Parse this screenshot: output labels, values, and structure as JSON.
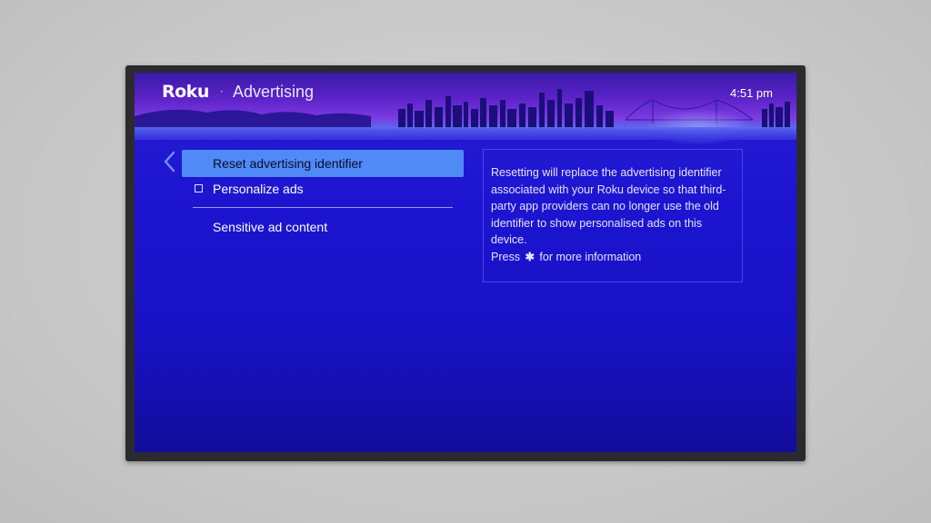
{
  "header": {
    "brand": "Roku",
    "separator": "·",
    "title": "Advertising",
    "time": "4:51 pm"
  },
  "navigation": {
    "back_icon": "chevron-left-icon"
  },
  "menu": {
    "items": [
      {
        "label": "Reset advertising identifier",
        "selected": true,
        "checkbox": false
      },
      {
        "label": "Personalize ads",
        "selected": false,
        "checkbox": true,
        "checked": false
      },
      {
        "label": "Sensitive ad content",
        "selected": false,
        "checkbox": false
      }
    ]
  },
  "info": {
    "description": "Resetting will replace the advertising identifier associated with your Roku device so that third-party app providers can no longer use the old identifier to show personalised ads on this device.",
    "press_prefix": "Press",
    "press_symbol": "✱",
    "press_suffix": "for more information"
  },
  "colors": {
    "screen_bg": "#1c14d0",
    "selected_bg": "#4f8af7",
    "bezel": "#2b2b2f"
  }
}
